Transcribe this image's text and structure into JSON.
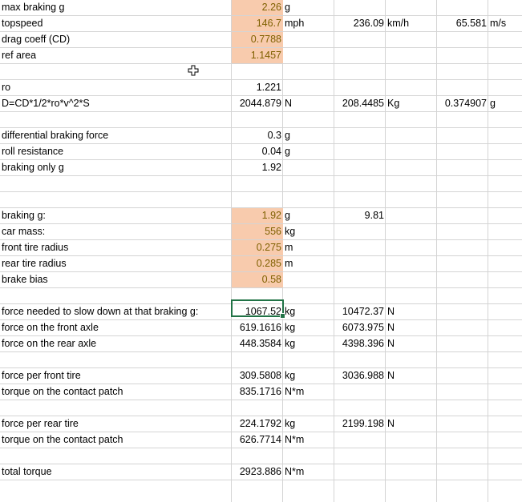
{
  "rows": [
    {
      "a": "max braking g",
      "b": "2.26",
      "c": "g",
      "d": "",
      "e": "",
      "f": "",
      "g": "",
      "hl": true
    },
    {
      "a": "topspeed",
      "b": "146.7",
      "c": "mph",
      "d": "236.09",
      "e": "km/h",
      "f": "65.581",
      "g": "m/s",
      "hl": true
    },
    {
      "a": "drag coeff (CD)",
      "b": "0.7788",
      "c": "",
      "d": "",
      "e": "",
      "f": "",
      "g": "",
      "hl": true
    },
    {
      "a": "ref area",
      "b": "1.1457",
      "c": "",
      "d": "",
      "e": "",
      "f": "",
      "g": "",
      "hl": true
    },
    {
      "a": "",
      "b": "",
      "c": "",
      "d": "",
      "e": "",
      "f": "",
      "g": "",
      "hl": false
    },
    {
      "a": "ro",
      "b": "1.221",
      "c": "",
      "d": "",
      "e": "",
      "f": "",
      "g": "",
      "hl": false
    },
    {
      "a": "D=CD*1/2*ro*v^2*S",
      "b": "2044.879",
      "c": "N",
      "d": "208.4485",
      "e": "Kg",
      "f": "0.374907",
      "g": "g",
      "hl": false
    },
    {
      "a": "",
      "b": "",
      "c": "",
      "d": "",
      "e": "",
      "f": "",
      "g": "",
      "hl": false
    },
    {
      "a": "differential braking force",
      "b": "0.3",
      "c": "g",
      "d": "",
      "e": "",
      "f": "",
      "g": "",
      "hl": false
    },
    {
      "a": "roll resistance",
      "b": "0.04",
      "c": "g",
      "d": "",
      "e": "",
      "f": "",
      "g": "",
      "hl": false
    },
    {
      "a": "braking only g",
      "b": "1.92",
      "c": "",
      "d": "",
      "e": "",
      "f": "",
      "g": "",
      "hl": false
    },
    {
      "a": "",
      "b": "",
      "c": "",
      "d": "",
      "e": "",
      "f": "",
      "g": "",
      "hl": false
    },
    {
      "a": "",
      "b": "",
      "c": "",
      "d": "",
      "e": "",
      "f": "",
      "g": "",
      "hl": false
    },
    {
      "a": "braking g:",
      "b": "1.92",
      "c": "g",
      "d": "9.81",
      "e": "",
      "f": "",
      "g": "",
      "hl": true
    },
    {
      "a": "car mass:",
      "b": "556",
      "c": "kg",
      "d": "",
      "e": "",
      "f": "",
      "g": "",
      "hl": true
    },
    {
      "a": "front tire radius",
      "b": "0.275",
      "c": "m",
      "d": "",
      "e": "",
      "f": "",
      "g": "",
      "hl": true
    },
    {
      "a": "rear tire radius",
      "b": "0.285",
      "c": "m",
      "d": "",
      "e": "",
      "f": "",
      "g": "",
      "hl": true
    },
    {
      "a": "brake bias",
      "b": "0.58",
      "c": "",
      "d": "",
      "e": "",
      "f": "",
      "g": "",
      "hl": true
    },
    {
      "a": "",
      "b": "",
      "c": "",
      "d": "",
      "e": "",
      "f": "",
      "g": "",
      "hl": false
    },
    {
      "a": "force needed to slow down at that braking g:",
      "b": "1067.52",
      "c": "kg",
      "d": "10472.37",
      "e": "N",
      "f": "",
      "g": "",
      "hl": false
    },
    {
      "a": "force on the front axle",
      "b": "619.1616",
      "c": "kg",
      "d": "6073.975",
      "e": "N",
      "f": "",
      "g": "",
      "hl": false
    },
    {
      "a": "force on the rear axle",
      "b": "448.3584",
      "c": "kg",
      "d": "4398.396",
      "e": "N",
      "f": "",
      "g": "",
      "hl": false
    },
    {
      "a": "",
      "b": "",
      "c": "",
      "d": "",
      "e": "",
      "f": "",
      "g": "",
      "hl": false
    },
    {
      "a": "force per front tire",
      "b": "309.5808",
      "c": "kg",
      "d": "3036.988",
      "e": "N",
      "f": "",
      "g": "",
      "hl": false
    },
    {
      "a": "torque on the contact patch",
      "b": "835.1716",
      "c": "N*m",
      "d": "",
      "e": "",
      "f": "",
      "g": "",
      "hl": false
    },
    {
      "a": "",
      "b": "",
      "c": "",
      "d": "",
      "e": "",
      "f": "",
      "g": "",
      "hl": false
    },
    {
      "a": "force per rear tire",
      "b": "224.1792",
      "c": "kg",
      "d": "2199.198",
      "e": "N",
      "f": "",
      "g": "",
      "hl": false
    },
    {
      "a": "torque on the contact patch",
      "b": "626.7714",
      "c": "N*m",
      "d": "",
      "e": "",
      "f": "",
      "g": "",
      "hl": false
    },
    {
      "a": "",
      "b": "",
      "c": "",
      "d": "",
      "e": "",
      "f": "",
      "g": "",
      "hl": false
    },
    {
      "a": "total torque",
      "b": "2923.886",
      "c": "N*m",
      "d": "",
      "e": "",
      "f": "",
      "g": "",
      "hl": false
    }
  ],
  "selected_row": 19,
  "colors": {
    "highlight_fill": "#f8cbad",
    "highlight_text": "#7f6000",
    "selection_border": "#217346",
    "gridline": "#d4d4d4"
  },
  "cursor_icon": "cross-cursor-icon"
}
